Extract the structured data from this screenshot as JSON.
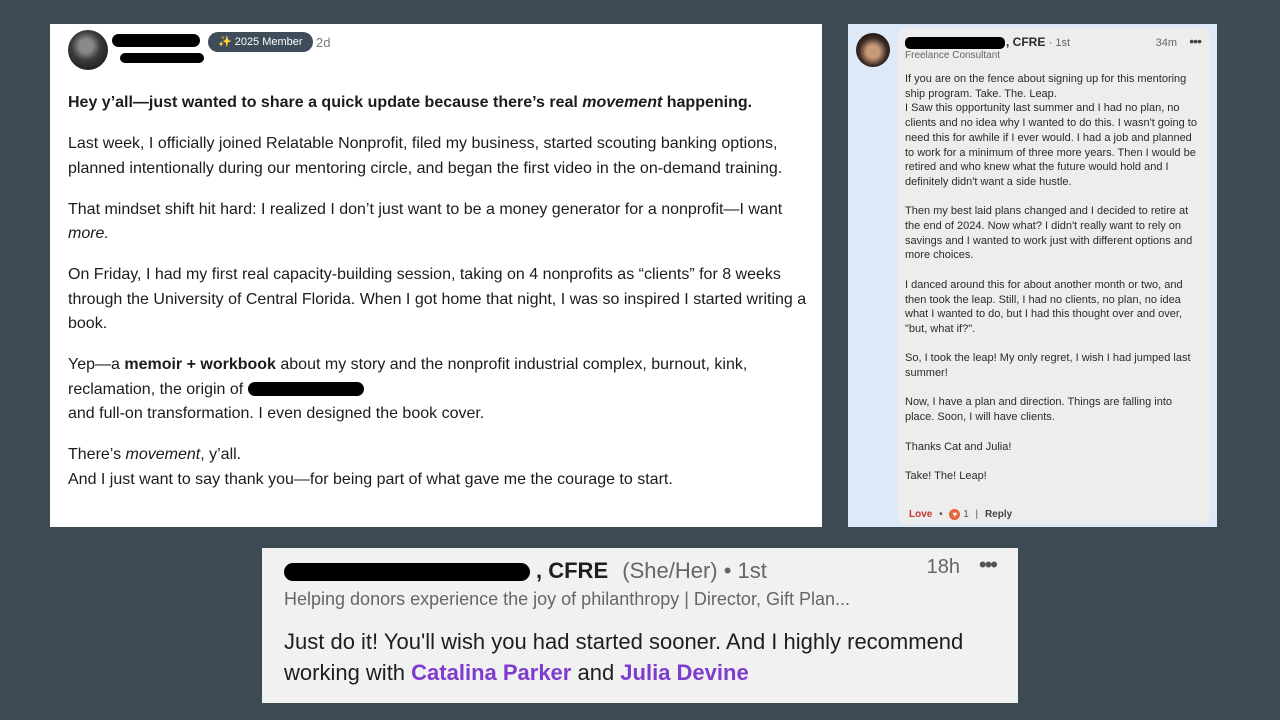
{
  "post": {
    "badge": "2025 Member",
    "badge_icon": "sparkle-icon",
    "age": "2d",
    "paragraphs": {
      "p1_a": "Hey y’all—just wanted to share a quick update because there’s real ",
      "p1_em": "movement",
      "p1_b": " happening.",
      "p2": "Last week, I officially joined Relatable Nonprofit, filed my business, started scouting banking options, planned intentionally during our mentoring circle, and began the first video in the on-demand training.",
      "p3_a": "That mindset shift hit hard: I realized I don’t just want to be a money generator for a nonprofit—I want ",
      "p3_em": "more.",
      "p4": "On Friday, I had my first real capacity-building session, taking on 4 nonprofits as “clients” for 8 weeks through the University of Central Florida. When I got home that night, I was so inspired I started writing a book.",
      "p5_a": "Yep—a ",
      "p5_strong": "memoir + workbook",
      "p5_b": " about my story and the nonprofit industrial complex, burnout, kink, reclamation, the origin of",
      "p5_c": "and full-on transformation. I even designed the book cover.",
      "p6_a": "There’s ",
      "p6_em": "movement",
      "p6_b": ", y’all.",
      "p6_c": "And I just want to say thank you—for being part of what gave me the courage to start."
    }
  },
  "comment": {
    "credential": ", CFRE",
    "degree": "· 1st",
    "time": "34m",
    "more": "•••",
    "headline": "Freelance Consultant",
    "paragraphs": [
      "If you are on the fence about signing up for this mentoring ship program. Take. The. Leap.\nI Saw this opportunity last summer and I had no plan, no clients and no idea why I wanted to do this. I wasn't going to need this for awhile if I ever would. I had a job and planned to work for a minimum of three more years. Then I would be retired and who knew what the future would hold and I definitely didn't want a side hustle.",
      "Then my best laid plans changed and I decided to retire at the end of 2024. Now what? I didn't really want to rely on savings and I wanted to work just with different options and more choices.",
      "I danced around this for about another month or two, and then took the leap. Still, I had no clients, no plan, no idea what I wanted to do, but I had this thought over and over, \"but, what if?\".",
      "So, I took the leap! My only regret, I wish I had jumped last summer!",
      "Now, I have a plan and direction. Things are falling into place. Soon, I will have clients.",
      "Thanks  Cat and Julia!",
      "Take! The! Leap!"
    ],
    "actions": {
      "love": "Love",
      "dot": "•",
      "reaction_count": "1",
      "reply": "Reply",
      "reaction_icon": "heart-icon"
    }
  },
  "highlight": {
    "credential": ", CFRE",
    "pronouns": "(She/Her)",
    "degree": "• 1st",
    "time": "18h",
    "more": "•••",
    "headline": "Helping donors experience the joy of philanthropy | Director, Gift Plan...",
    "message_a": "Just do it! You'll wish you had started sooner. And I highly recommend working with ",
    "mention1": "Catalina Parker",
    "message_b": " and ",
    "mention2": "Julia Devine"
  },
  "colors": {
    "background": "#3c4a54",
    "badge": "#3f4c5a",
    "comment_bg": "#dde9f7",
    "bubble": "#ededed",
    "mention": "#7e3ccf",
    "love": "#c0392b"
  }
}
